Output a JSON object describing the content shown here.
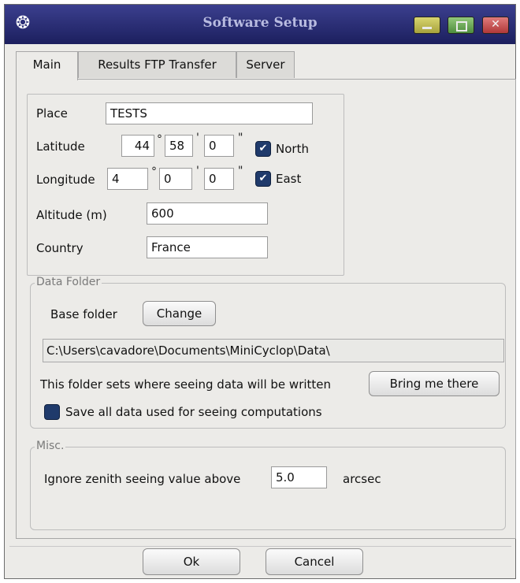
{
  "window": {
    "title": "Software Setup"
  },
  "tabs": [
    {
      "label": "Main",
      "active": true
    },
    {
      "label": "Results FTP Transfer",
      "active": false
    },
    {
      "label": "Server",
      "active": false
    }
  ],
  "location": {
    "place_label": "Place",
    "place_value": "TESTS",
    "latitude_label": "Latitude",
    "latitude_deg": "44",
    "latitude_min": "58",
    "latitude_sec": "0",
    "north_label": "North",
    "north_checked": true,
    "longitude_label": "Longitude",
    "longitude_deg": "4",
    "longitude_min": "0",
    "longitude_sec": "0",
    "east_label": "East",
    "east_checked": true,
    "altitude_label": "Altitude (m)",
    "altitude_value": "600",
    "country_label": "Country",
    "country_value": "France",
    "degree_symbol": "°",
    "minute_symbol": "'",
    "second_symbol": "\""
  },
  "data_folder": {
    "group_title": "Data Folder",
    "base_folder_label": "Base folder",
    "change_button": "Change",
    "path_value": "C:\\Users\\cavadore\\Documents\\MiniCyclop\\Data\\",
    "description": "This folder sets where seeing data will be written",
    "bring_button": "Bring me there",
    "save_all_label": "Save all data used for seeing computations",
    "save_all_checked": false
  },
  "misc": {
    "group_title": "Misc.",
    "ignore_label": "Ignore zenith seeing value above",
    "ignore_value": "5.0",
    "unit": "arcsec"
  },
  "dialog_buttons": {
    "ok": "Ok",
    "cancel": "Cancel"
  },
  "icons": {
    "app_logo": "app-logo-icon",
    "check": "checkmark-icon"
  },
  "colors": {
    "titlebar": "#2a2e74",
    "checkbox": "#1f3a6b",
    "panel": "#ecebe8"
  }
}
